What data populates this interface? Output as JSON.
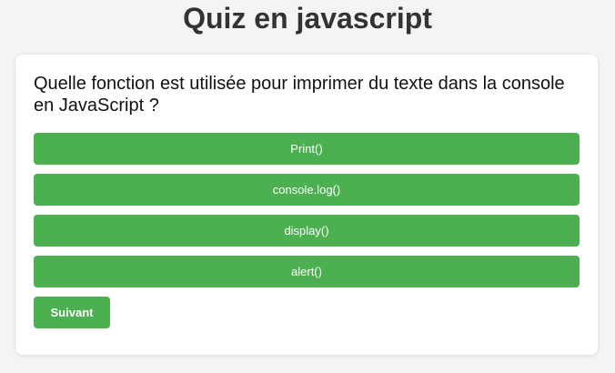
{
  "page": {
    "title": "Quiz en javascript"
  },
  "quiz": {
    "question": "Quelle fonction est utilisée pour imprimer du texte dans la console en JavaScript ?",
    "answers": [
      "Print()",
      "console.log()",
      "display()",
      "alert()"
    ],
    "next_label": "Suivant"
  },
  "colors": {
    "background": "#f4f4f4",
    "card": "#ffffff",
    "button": "#4caf50",
    "button_text": "#ffffff",
    "title_text": "#333333"
  }
}
